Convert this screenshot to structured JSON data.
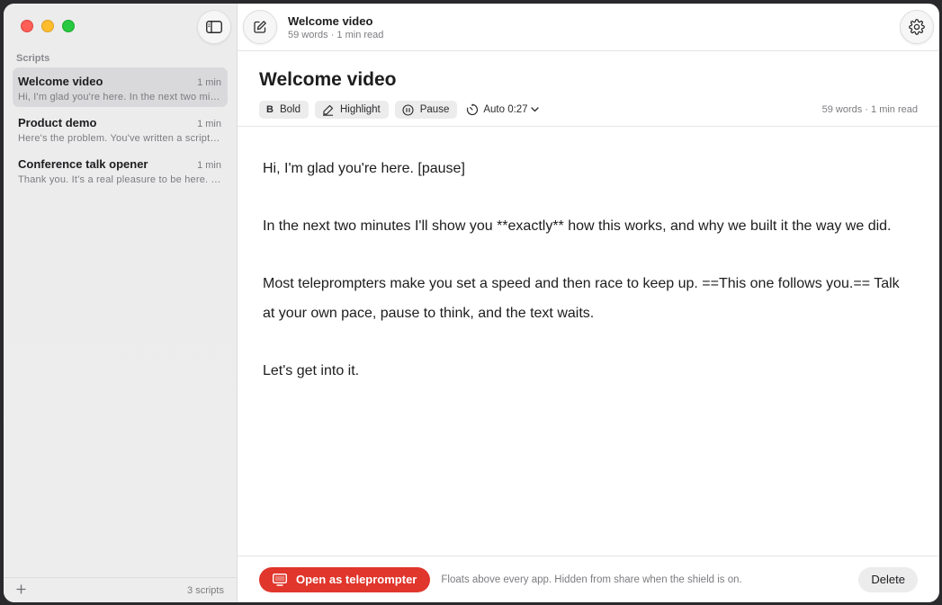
{
  "sidebar": {
    "section_label": "Scripts",
    "items": [
      {
        "title": "Welcome video",
        "duration": "1 min",
        "preview": "Hi, I'm glad you're here. In the next two minutes I'll show you"
      },
      {
        "title": "Product demo",
        "duration": "1 min",
        "preview": "Here's the problem. You've written a script and"
      },
      {
        "title": "Conference talk opener",
        "duration": "1 min",
        "preview": "Thank you. It's a real pleasure to be here. Today"
      }
    ],
    "add_label": "+",
    "count_label": "3 scripts"
  },
  "topbar": {
    "title": "Welcome video",
    "subtitle": "59 words · 1 min read"
  },
  "document": {
    "title": "Welcome video",
    "stats": "59 words · 1 min read",
    "paragraphs": [
      "Hi, I'm glad you're here. [pause]",
      "In the next two minutes I'll show you **exactly** how this works, and why we built it the way we did.",
      "Most teleprompters make you set a speed and then race to keep up. ==This one follows you.== Talk at your own pace, pause to think, and the text waits.",
      "Let's get into it."
    ]
  },
  "toolbar": {
    "bold_glyph": "B",
    "bold_label": "Bold",
    "highlight_label": "Highlight",
    "pause_label": "Pause",
    "auto_label": "Auto 0:27"
  },
  "footer": {
    "open_label": "Open as teleprompter",
    "note": "Floats above every app. Hidden from share when the shield is on.",
    "delete_label": "Delete"
  },
  "colors": {
    "accent_red": "#e0362c",
    "selected_row": "#d9d9db",
    "sidebar_bg": "#ececed"
  },
  "icons": [
    "sidebar-toggle-icon",
    "compose-icon",
    "gear-icon",
    "highlighter-icon",
    "pause-circle-icon",
    "timer-icon",
    "chevron-down-icon",
    "monitor-icon",
    "plus-icon"
  ]
}
